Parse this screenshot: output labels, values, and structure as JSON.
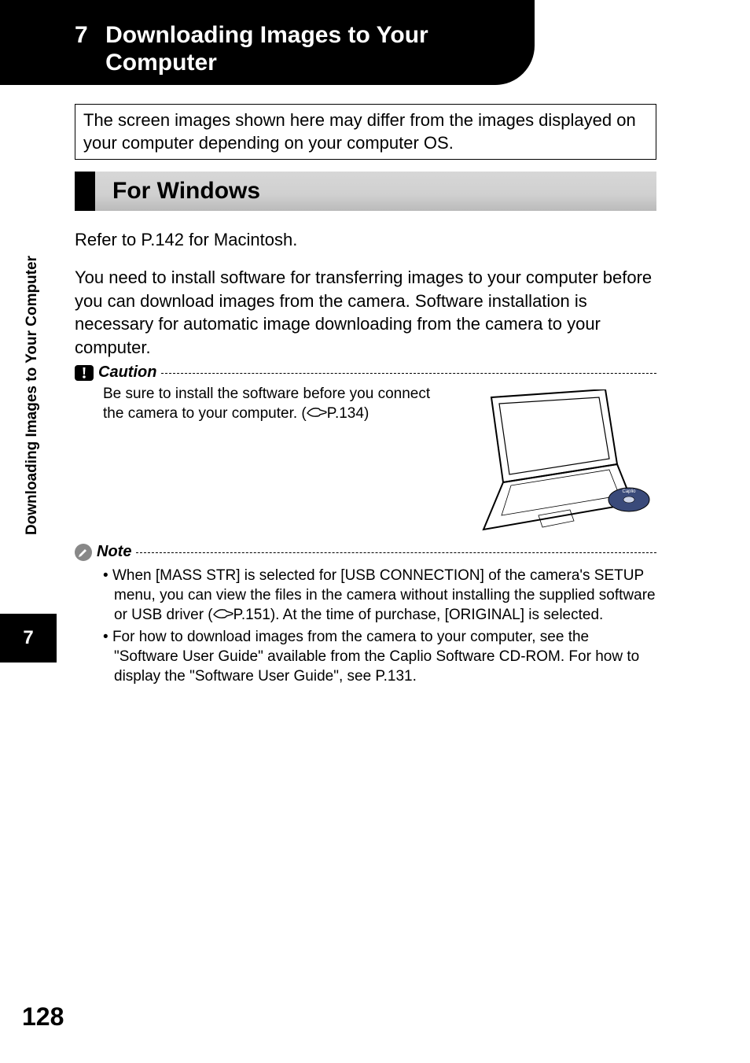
{
  "chapter": {
    "number": "7",
    "title": "Downloading Images to Your Computer"
  },
  "info_box": "The screen images shown here may differ from the images displayed on your computer depending on your computer OS.",
  "section_heading": "For Windows",
  "refer_text": "Refer to P.142 for Macintosh.",
  "intro_text": "You need to install software for transferring images to your computer before you can download images from the camera. Software installation is necessary for automatic image downloading from the camera to your computer.",
  "caution": {
    "label": "Caution",
    "text_before": "Be sure to install the software before you connect the camera to your computer. (",
    "page_ref": "P.134)",
    "icon_name": "caution-icon"
  },
  "note": {
    "label": "Note",
    "icon_name": "note-icon",
    "items": [
      {
        "before": "When [MASS STR] is selected for [USB CONNECTION] of the camera's SETUP menu, you can view the files in the camera without installing the supplied software or USB driver (",
        "ref": "P.151). At the time of purchase, [ORIGINAL] is selected."
      },
      {
        "before": "For how to download images from the camera to your computer, see the \"Software User Guide\" available from the Caplio Software CD-ROM. For how to display the \"Software User Guide\", see P.131.",
        "ref": ""
      }
    ]
  },
  "side": {
    "text": "Downloading Images to Your Computer",
    "tab_number": "7"
  },
  "page_number": "128"
}
